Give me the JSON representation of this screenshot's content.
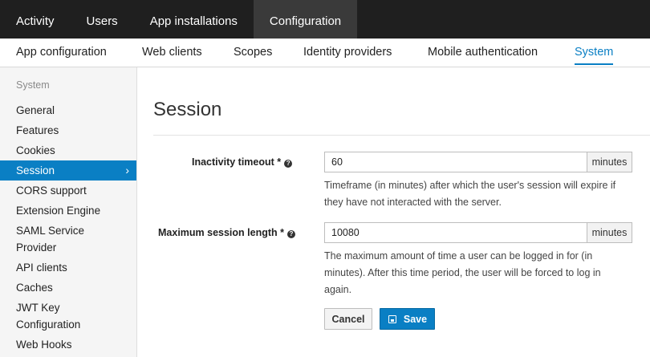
{
  "topnav": {
    "tabs": [
      {
        "label": "Activity"
      },
      {
        "label": "Users"
      },
      {
        "label": "App installations"
      },
      {
        "label": "Configuration",
        "active": true
      }
    ]
  },
  "subnav": {
    "tabs": [
      {
        "label": "App configuration"
      },
      {
        "label": "Web clients"
      },
      {
        "label": "Scopes"
      },
      {
        "label": "Identity providers"
      },
      {
        "label": "Mobile authentication"
      },
      {
        "label": "System",
        "active": true
      }
    ]
  },
  "sidebar": {
    "heading": "System",
    "items": [
      {
        "label": "General"
      },
      {
        "label": "Features"
      },
      {
        "label": "Cookies"
      },
      {
        "label": "Session",
        "active": true
      },
      {
        "label": "CORS support"
      },
      {
        "label": "Extension Engine"
      },
      {
        "label": "SAML Service Provider"
      },
      {
        "label": "API clients"
      },
      {
        "label": "Caches"
      },
      {
        "label": "JWT Key Configuration"
      },
      {
        "label": "Web Hooks"
      }
    ]
  },
  "main": {
    "title": "Session",
    "inactivity": {
      "label": "Inactivity timeout *",
      "value": "60",
      "unit": "minutes",
      "help": "Timeframe (in minutes) after which the user's session will expire if they have not interacted with the server."
    },
    "max_session": {
      "label": "Maximum session length *",
      "value": "10080",
      "unit": "minutes",
      "help": "The maximum amount of time a user can be logged in for (in minutes). After this time period, the user will be forced to log in again."
    },
    "cancel_label": "Cancel",
    "save_label": "Save"
  }
}
